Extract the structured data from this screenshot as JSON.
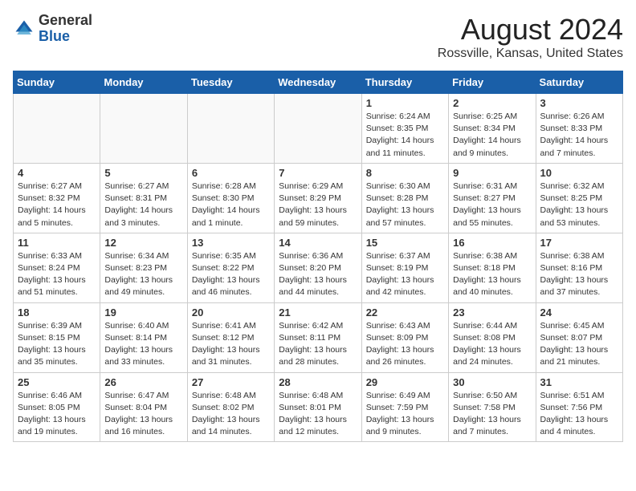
{
  "header": {
    "logo_general": "General",
    "logo_blue": "Blue",
    "month_title": "August 2024",
    "location": "Rossville, Kansas, United States"
  },
  "days_of_week": [
    "Sunday",
    "Monday",
    "Tuesday",
    "Wednesday",
    "Thursday",
    "Friday",
    "Saturday"
  ],
  "weeks": [
    [
      {
        "num": "",
        "info": ""
      },
      {
        "num": "",
        "info": ""
      },
      {
        "num": "",
        "info": ""
      },
      {
        "num": "",
        "info": ""
      },
      {
        "num": "1",
        "info": "Sunrise: 6:24 AM\nSunset: 8:35 PM\nDaylight: 14 hours\nand 11 minutes."
      },
      {
        "num": "2",
        "info": "Sunrise: 6:25 AM\nSunset: 8:34 PM\nDaylight: 14 hours\nand 9 minutes."
      },
      {
        "num": "3",
        "info": "Sunrise: 6:26 AM\nSunset: 8:33 PM\nDaylight: 14 hours\nand 7 minutes."
      }
    ],
    [
      {
        "num": "4",
        "info": "Sunrise: 6:27 AM\nSunset: 8:32 PM\nDaylight: 14 hours\nand 5 minutes."
      },
      {
        "num": "5",
        "info": "Sunrise: 6:27 AM\nSunset: 8:31 PM\nDaylight: 14 hours\nand 3 minutes."
      },
      {
        "num": "6",
        "info": "Sunrise: 6:28 AM\nSunset: 8:30 PM\nDaylight: 14 hours\nand 1 minute."
      },
      {
        "num": "7",
        "info": "Sunrise: 6:29 AM\nSunset: 8:29 PM\nDaylight: 13 hours\nand 59 minutes."
      },
      {
        "num": "8",
        "info": "Sunrise: 6:30 AM\nSunset: 8:28 PM\nDaylight: 13 hours\nand 57 minutes."
      },
      {
        "num": "9",
        "info": "Sunrise: 6:31 AM\nSunset: 8:27 PM\nDaylight: 13 hours\nand 55 minutes."
      },
      {
        "num": "10",
        "info": "Sunrise: 6:32 AM\nSunset: 8:25 PM\nDaylight: 13 hours\nand 53 minutes."
      }
    ],
    [
      {
        "num": "11",
        "info": "Sunrise: 6:33 AM\nSunset: 8:24 PM\nDaylight: 13 hours\nand 51 minutes."
      },
      {
        "num": "12",
        "info": "Sunrise: 6:34 AM\nSunset: 8:23 PM\nDaylight: 13 hours\nand 49 minutes."
      },
      {
        "num": "13",
        "info": "Sunrise: 6:35 AM\nSunset: 8:22 PM\nDaylight: 13 hours\nand 46 minutes."
      },
      {
        "num": "14",
        "info": "Sunrise: 6:36 AM\nSunset: 8:20 PM\nDaylight: 13 hours\nand 44 minutes."
      },
      {
        "num": "15",
        "info": "Sunrise: 6:37 AM\nSunset: 8:19 PM\nDaylight: 13 hours\nand 42 minutes."
      },
      {
        "num": "16",
        "info": "Sunrise: 6:38 AM\nSunset: 8:18 PM\nDaylight: 13 hours\nand 40 minutes."
      },
      {
        "num": "17",
        "info": "Sunrise: 6:38 AM\nSunset: 8:16 PM\nDaylight: 13 hours\nand 37 minutes."
      }
    ],
    [
      {
        "num": "18",
        "info": "Sunrise: 6:39 AM\nSunset: 8:15 PM\nDaylight: 13 hours\nand 35 minutes."
      },
      {
        "num": "19",
        "info": "Sunrise: 6:40 AM\nSunset: 8:14 PM\nDaylight: 13 hours\nand 33 minutes."
      },
      {
        "num": "20",
        "info": "Sunrise: 6:41 AM\nSunset: 8:12 PM\nDaylight: 13 hours\nand 31 minutes."
      },
      {
        "num": "21",
        "info": "Sunrise: 6:42 AM\nSunset: 8:11 PM\nDaylight: 13 hours\nand 28 minutes."
      },
      {
        "num": "22",
        "info": "Sunrise: 6:43 AM\nSunset: 8:09 PM\nDaylight: 13 hours\nand 26 minutes."
      },
      {
        "num": "23",
        "info": "Sunrise: 6:44 AM\nSunset: 8:08 PM\nDaylight: 13 hours\nand 24 minutes."
      },
      {
        "num": "24",
        "info": "Sunrise: 6:45 AM\nSunset: 8:07 PM\nDaylight: 13 hours\nand 21 minutes."
      }
    ],
    [
      {
        "num": "25",
        "info": "Sunrise: 6:46 AM\nSunset: 8:05 PM\nDaylight: 13 hours\nand 19 minutes."
      },
      {
        "num": "26",
        "info": "Sunrise: 6:47 AM\nSunset: 8:04 PM\nDaylight: 13 hours\nand 16 minutes."
      },
      {
        "num": "27",
        "info": "Sunrise: 6:48 AM\nSunset: 8:02 PM\nDaylight: 13 hours\nand 14 minutes."
      },
      {
        "num": "28",
        "info": "Sunrise: 6:48 AM\nSunset: 8:01 PM\nDaylight: 13 hours\nand 12 minutes."
      },
      {
        "num": "29",
        "info": "Sunrise: 6:49 AM\nSunset: 7:59 PM\nDaylight: 13 hours\nand 9 minutes."
      },
      {
        "num": "30",
        "info": "Sunrise: 6:50 AM\nSunset: 7:58 PM\nDaylight: 13 hours\nand 7 minutes."
      },
      {
        "num": "31",
        "info": "Sunrise: 6:51 AM\nSunset: 7:56 PM\nDaylight: 13 hours\nand 4 minutes."
      }
    ]
  ]
}
